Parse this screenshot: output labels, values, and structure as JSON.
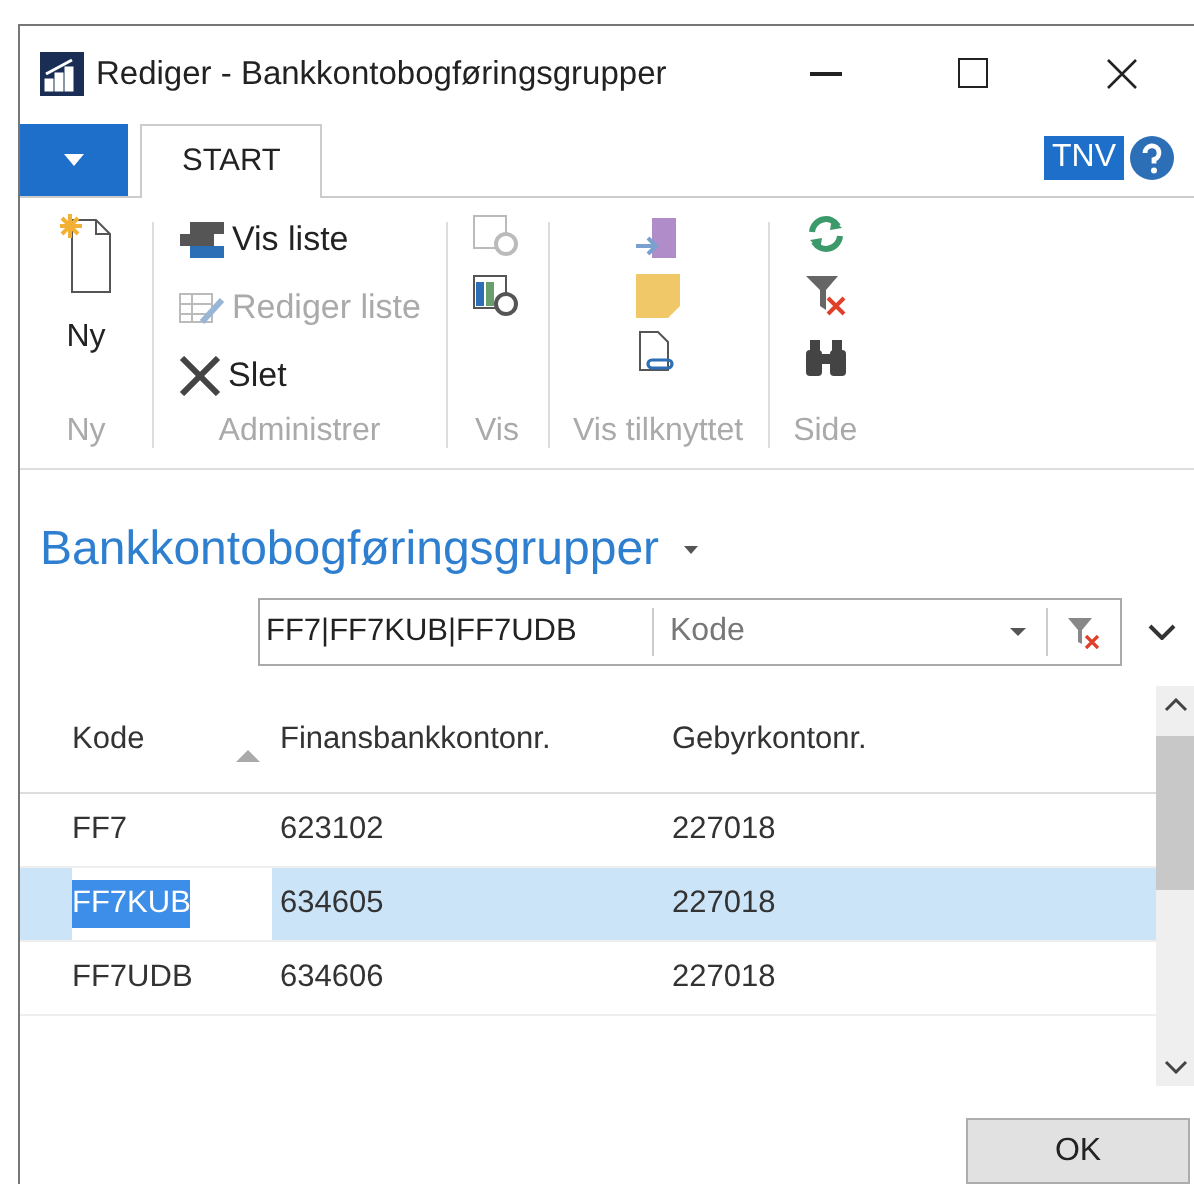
{
  "window": {
    "title": "Rediger - Bankkontobogføringsgrupper"
  },
  "tabs": [
    {
      "label": "START",
      "selected": true
    }
  ],
  "user_badge": "TNV",
  "ribbon": {
    "groups": [
      {
        "label": "Ny",
        "actions": [
          {
            "label": "Ny",
            "disabled": false
          }
        ]
      },
      {
        "label": "Administrer",
        "actions": [
          {
            "label": "Vis liste",
            "disabled": false
          },
          {
            "label": "Rediger liste",
            "disabled": true
          },
          {
            "label": "Slet",
            "disabled": false
          }
        ]
      },
      {
        "label": "Vis"
      },
      {
        "label": "Vis tilknyttet"
      },
      {
        "label": "Side"
      }
    ]
  },
  "page_title": "Bankkontobogføringsgrupper",
  "filter": {
    "value": "FF7|FF7KUB|FF7UDB",
    "field": "Kode"
  },
  "table": {
    "columns": [
      {
        "label": "Kode",
        "sorted": true
      },
      {
        "label": "Finansbankkontonr.",
        "sorted": false
      },
      {
        "label": "Gebyrkontonr.",
        "sorted": false
      }
    ],
    "rows": [
      {
        "cells": [
          "FF7",
          "623102",
          "227018"
        ],
        "selected": false
      },
      {
        "cells": [
          "FF7KUB",
          "634605",
          "227018"
        ],
        "selected": true
      },
      {
        "cells": [
          "FF7UDB",
          "634606",
          "227018"
        ],
        "selected": false
      }
    ]
  },
  "buttons": [
    "OK"
  ]
}
